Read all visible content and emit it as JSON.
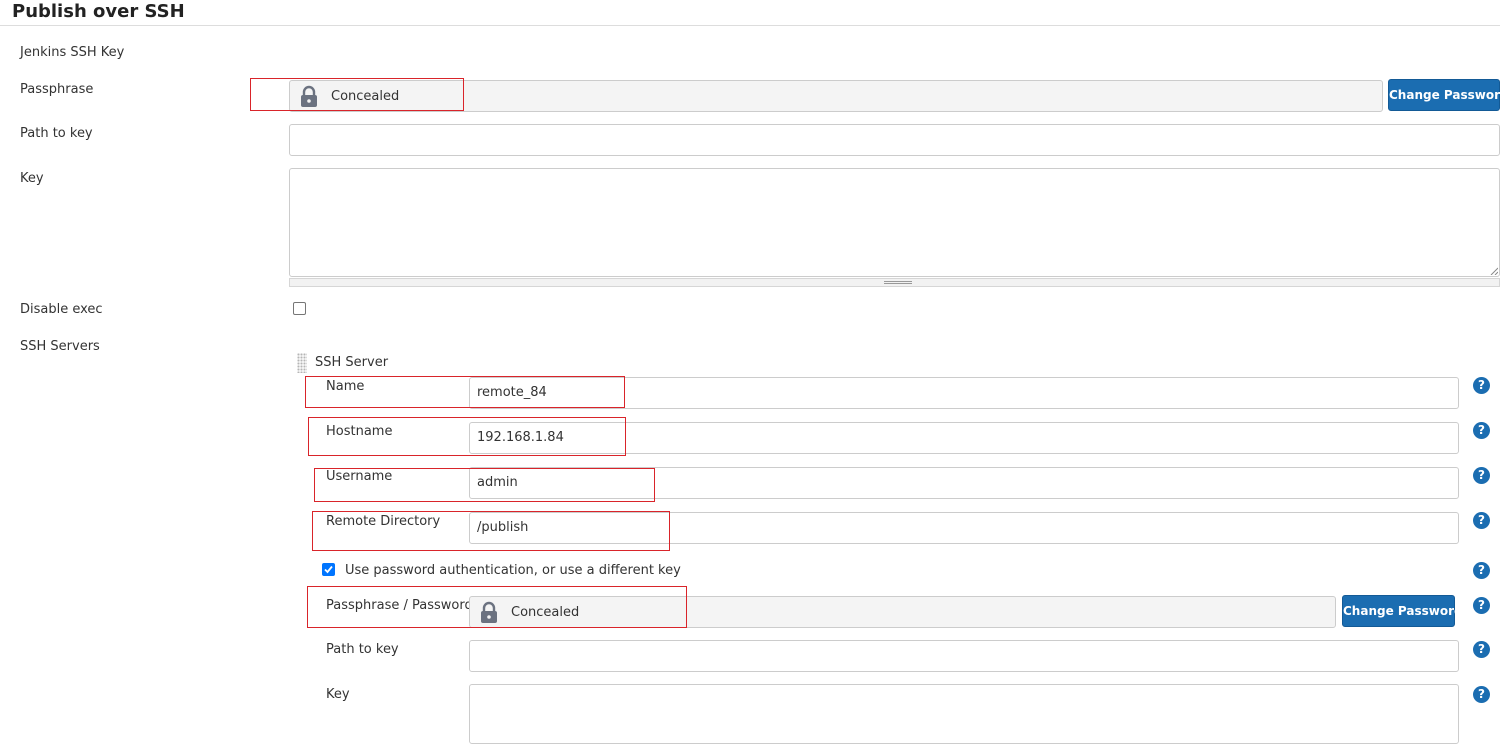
{
  "section": {
    "title": "Publish over SSH"
  },
  "global": {
    "jenkins_ssh_key_label": "Jenkins SSH Key",
    "passphrase_label": "Passphrase",
    "passphrase_value": "Concealed",
    "change_password_label": "Change Password",
    "path_to_key_label": "Path to key",
    "path_to_key_value": "",
    "key_label": "Key",
    "key_value": "",
    "disable_exec_label": "Disable exec",
    "disable_exec_checked": false,
    "ssh_servers_label": "SSH Servers"
  },
  "server": {
    "header": "SSH Server",
    "name_label": "Name",
    "name_value": "remote_84",
    "hostname_label": "Hostname",
    "hostname_value": "192.168.1.84",
    "username_label": "Username",
    "username_value": "admin",
    "remote_directory_label": "Remote Directory",
    "remote_directory_value": "/publish",
    "use_password_label": "Use password authentication, or use a different key",
    "use_password_checked": true,
    "passphrase_password_label": "Passphrase / Password",
    "passphrase_password_value": "Concealed",
    "change_password_label": "Change Password",
    "path_to_key_label": "Path to key",
    "path_to_key_value": "",
    "key_label": "Key",
    "key_value": ""
  },
  "help_icon_glyph": "?",
  "colors": {
    "button_bg": "#1b6db1",
    "highlight_border": "#d9242a",
    "checkbox_checked": "#0075ff"
  }
}
